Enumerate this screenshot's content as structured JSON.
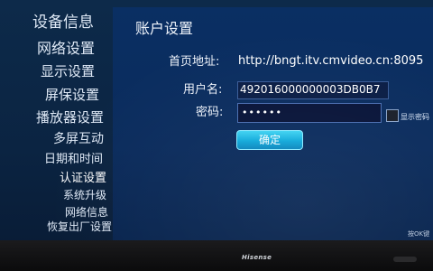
{
  "sidebar": {
    "items": [
      {
        "label": "设备信息"
      },
      {
        "label": "网络设置"
      },
      {
        "label": "显示设置"
      },
      {
        "label": "屏保设置"
      },
      {
        "label": "播放器设置"
      },
      {
        "label": "多屏互动"
      },
      {
        "label": "日期和时间"
      },
      {
        "label": "认证设置"
      },
      {
        "label": "系统升级"
      },
      {
        "label": "网络信息"
      },
      {
        "label": "恢复出厂设置"
      }
    ]
  },
  "panel": {
    "title": "账户设置",
    "homepage": {
      "label": "首页地址:",
      "value": "http://bngt.itv.cmvideo.cn:8095"
    },
    "username": {
      "label": "用户名:",
      "value": "492016000000003DB0B7"
    },
    "password": {
      "label": "密码:",
      "value": "••••••"
    },
    "show_password_label": "显示密码",
    "confirm_label": "确定",
    "hint": "按OK键"
  },
  "tv": {
    "brand": "Hisense"
  },
  "colors": {
    "panel_bg": "#0a2f63",
    "button_accent": "#10a9da",
    "selected_item": "#ffffff"
  }
}
